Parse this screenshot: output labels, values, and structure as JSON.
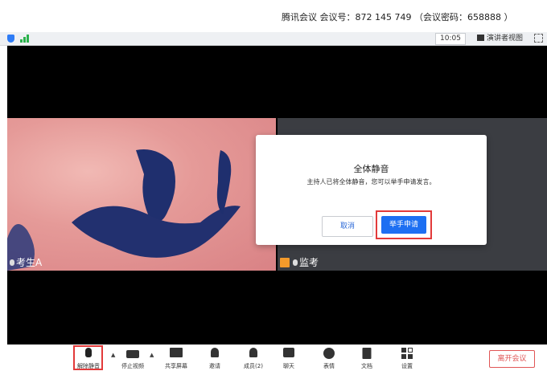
{
  "window": {
    "title": "腾讯会议 会议号：872 145 749 （会议密码：658888 ）"
  },
  "topbar": {
    "time": "10:05",
    "view_label": "演讲者视图",
    "icons": [
      "shield-icon",
      "signal-icon",
      "speaker-view-icon",
      "fullscreen-icon"
    ]
  },
  "colors": {
    "accent": "#1d6ff2",
    "highlight": "#e23a3a",
    "leave": "#e05555",
    "signal": "#2bb24c"
  },
  "participants": [
    {
      "name": "考生A",
      "muted": true
    },
    {
      "name": "监考",
      "muted": true,
      "host": true
    }
  ],
  "dialog": {
    "title": "全体静音",
    "message": "主持人已将全体静音，您可以举手申请发言。",
    "cancel_label": "取消",
    "raise_hand_label": "举手申请"
  },
  "toolbar": {
    "items": [
      {
        "label": "解除静音",
        "icon": "mic-muted-icon"
      },
      {
        "label": "停止视频",
        "icon": "video-icon"
      },
      {
        "label": "共享屏幕",
        "icon": "share-screen-icon"
      },
      {
        "label": "邀请",
        "icon": "invite-icon"
      },
      {
        "label": "成员(2)",
        "icon": "members-icon"
      },
      {
        "label": "聊天",
        "icon": "chat-icon"
      },
      {
        "label": "表情",
        "icon": "emoji-icon"
      },
      {
        "label": "文档",
        "icon": "document-icon"
      },
      {
        "label": "设置",
        "icon": "settings-icon"
      }
    ],
    "leave_label": "离开会议"
  }
}
